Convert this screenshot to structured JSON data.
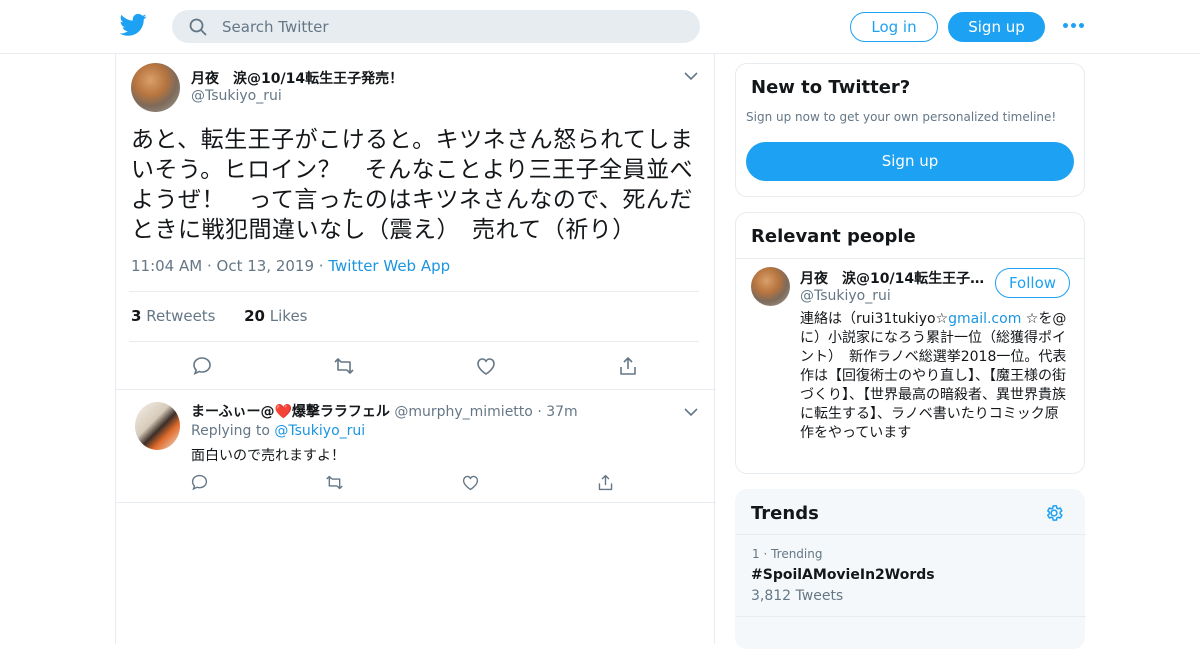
{
  "header": {
    "search_placeholder": "Search Twitter",
    "login_label": "Log in",
    "signup_label": "Sign up"
  },
  "tweet": {
    "author_name": "月夜　涙@10/14転生王子発売！",
    "author_handle": "@Tsukiyo_rui",
    "text": "あと、転生王子がこけると。キツネさん怒られてしまいそう。ヒロイン？　そんなことより三王子全員並べようぜ！　って言ったのはキツネさんなので、死んだときに戦犯間違いなし（震え）　売れて（祈り）",
    "time": "11:04 AM",
    "date": "Oct 13, 2019",
    "source": "Twitter Web App",
    "retweets_count": "3",
    "retweets_label": "Retweets",
    "likes_count": "20",
    "likes_label": "Likes"
  },
  "reply": {
    "author_name": "まーふぃー@❤️爆撃ララフェル",
    "author_handle": "@murphy_mimietto",
    "time": "37m",
    "replying_prefix": "Replying to",
    "replying_to": "@Tsukiyo_rui",
    "text": "面白いので売れますよ！"
  },
  "sidebar": {
    "new_title": "New to Twitter?",
    "new_sub": "Sign up now to get your own personalized timeline!",
    "new_button": "Sign up",
    "relevant_title": "Relevant people",
    "person_name": "月夜　涙@10/14転生王子…",
    "person_handle": "@Tsukiyo_rui",
    "follow_label": "Follow",
    "bio_a": "連絡は（rui31tukiyo☆",
    "bio_link": "gmail.com",
    "bio_b": " ☆を@に）小説家になろう累計一位（総獲得ポイント）　新作ラノベ総選挙2018一位。代表作は【回復術士のやり直し】、【魔王様の街づくり】、【世界最高の暗殺者、異世界貴族に転生する】、ラノベ書いたりコミック原作をやっています",
    "trends_title": "Trends",
    "trend_rank": "1 · Trending",
    "trend_tag": "#SpoilAMovieIn2Words",
    "trend_count": "3,812 Tweets"
  }
}
